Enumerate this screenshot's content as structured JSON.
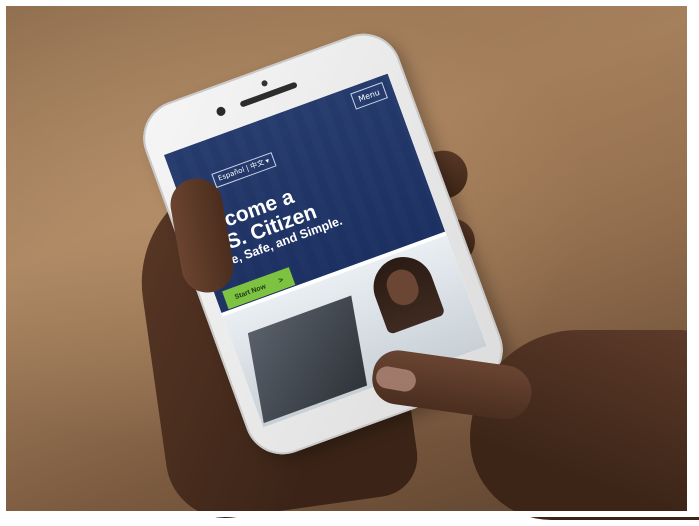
{
  "screen": {
    "language_label": "Español | 中文 ▾",
    "menu_label": "Menu",
    "headline_line1": "Become a",
    "headline_line2": "U.S. Citizen",
    "subheadline": "Free, Safe, and Simple.",
    "cta_label": "Start Now",
    "cta_chevron": ">"
  },
  "colors": {
    "hero_blue": "#223869",
    "cta_green": "#7dc241"
  },
  "icons": {
    "logo": "gear-logo-icon"
  }
}
